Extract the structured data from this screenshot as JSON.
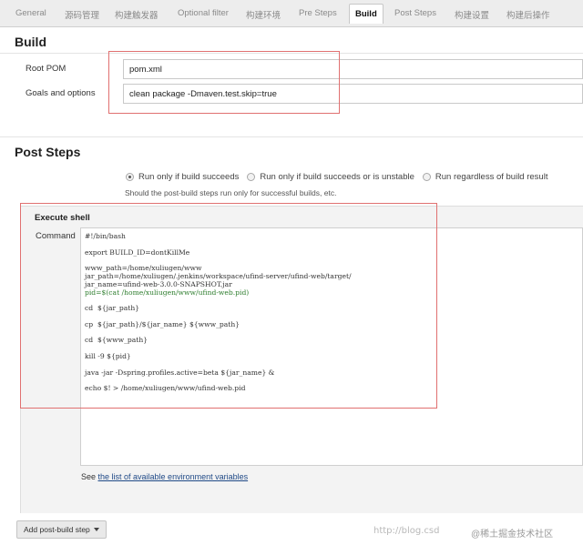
{
  "tabs": [
    {
      "label": "General"
    },
    {
      "label": "源码管理"
    },
    {
      "label": "构建触发器"
    },
    {
      "label": "Optional filter"
    },
    {
      "label": "构建环境"
    },
    {
      "label": "Pre Steps"
    },
    {
      "label": "Build"
    },
    {
      "label": "Post Steps"
    },
    {
      "label": "构建设置"
    },
    {
      "label": "构建后操作"
    }
  ],
  "build": {
    "title": "Build",
    "root_pom_label": "Root POM",
    "root_pom_value": "pom.xml",
    "goals_label": "Goals and options",
    "goals_value": "clean package -Dmaven.test.skip=true"
  },
  "post_steps": {
    "title": "Post Steps",
    "options": [
      {
        "label": "Run only if build succeeds",
        "checked": true
      },
      {
        "label": "Run only if build succeeds or is unstable",
        "checked": false
      },
      {
        "label": "Run regardless of build result",
        "checked": false
      }
    ],
    "hint": "Should the post-build steps run only for successful builds, etc."
  },
  "execute_shell": {
    "title": "Execute shell",
    "command_label": "Command",
    "lines": [
      "#!/bin/bash",
      "",
      "export BUILD_ID=dontKillMe",
      "",
      "www_path=/home/xuliugen/www",
      "jar_path=/home/xuliugen/.jenkins/workspace/ufind-server/ufind-web/target/",
      "jar_name=ufind-web-3.0.0-SNAPSHOT.jar",
      "pid=$(cat /home/xuliugen/www/ufind-web.pid)",
      "",
      "cd  ${jar_path}",
      "",
      "cp  ${jar_path}/${jar_name} ${www_path}",
      "",
      "cd  ${www_path}",
      "",
      "kill -9 ${pid}",
      "",
      "java -jar -Dspring.profiles.active=beta ${jar_name} &",
      "",
      "echo $! > /home/xuliugen/www/ufind-web.pid"
    ]
  },
  "env_vars": {
    "prefix": "See ",
    "link": "the list of available environment variables"
  },
  "add_post_build_step": "Add post-build step",
  "watermark": {
    "url": "http://blog.csd",
    "brand": "@稀土掘金技术社区"
  },
  "colors": {
    "highlight_border": "#e07070",
    "link": "#204a87"
  }
}
